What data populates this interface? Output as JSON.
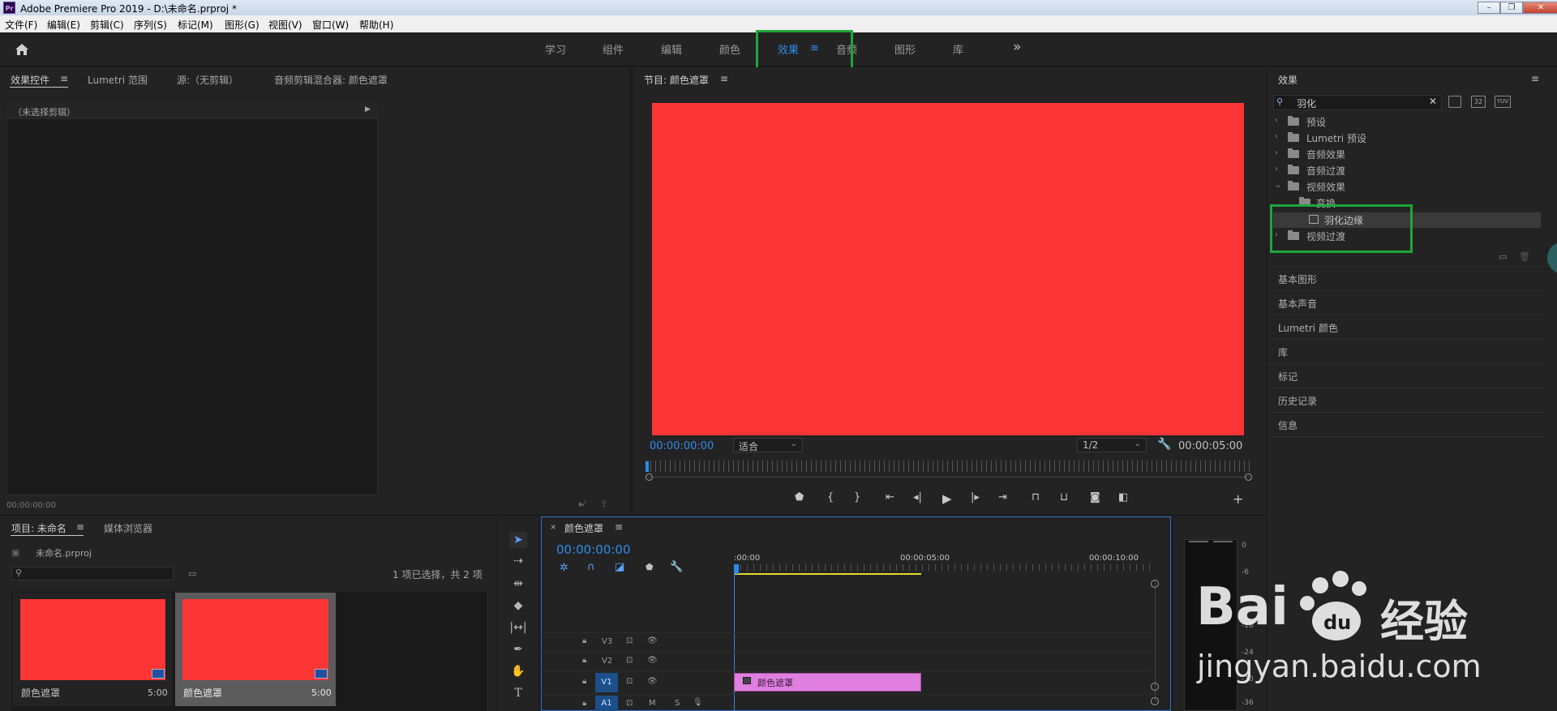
{
  "window": {
    "app_icon": "Pr",
    "title": "Adobe Premiere Pro 2019 - D:\\未命名.prproj *",
    "minimize": "–",
    "restore": "❐",
    "close": "✕"
  },
  "menu": [
    "文件(F)",
    "编辑(E)",
    "剪辑(C)",
    "序列(S)",
    "标记(M)",
    "图形(G)",
    "视图(V)",
    "窗口(W)",
    "帮助(H)"
  ],
  "workspaces": {
    "items": [
      "学习",
      "组件",
      "编辑",
      "颜色",
      "效果",
      "音频",
      "图形",
      "库"
    ],
    "active": "效果",
    "more": "»"
  },
  "effect_controls": {
    "tabs": [
      "效果控件",
      "Lumetri 范围",
      "源:（无剪辑）",
      "音频剪辑混合器: 颜色遮罩"
    ],
    "no_clip": "（未选择剪辑）",
    "timecode": "00:00:00:00"
  },
  "program_monitor": {
    "title": "节目: 颜色遮罩",
    "timecode": "00:00:00:00",
    "fit": "适合",
    "resolution": "1/2",
    "duration": "00:00:05:00",
    "frame_color": "#fd3535"
  },
  "effects_panel": {
    "title": "效果",
    "search_value": "羽化",
    "tree": [
      {
        "label": "预设",
        "chev": "›"
      },
      {
        "label": "Lumetri 预设",
        "chev": "›"
      },
      {
        "label": "音频效果",
        "chev": "›"
      },
      {
        "label": "音频过渡",
        "chev": "›"
      },
      {
        "label": "视频效果",
        "chev": "⌄"
      },
      {
        "label": "变换",
        "chev": ""
      },
      {
        "label": "羽化边缘",
        "chev": ""
      },
      {
        "label": "视频过渡",
        "chev": "›"
      }
    ],
    "badges": [
      "32",
      "YUV"
    ]
  },
  "side_panels": [
    "基本图形",
    "基本声音",
    "Lumetri 颜色",
    "库",
    "标记",
    "历史记录",
    "信息"
  ],
  "project": {
    "tabs": [
      "项目: 未命名",
      "媒体浏览器"
    ],
    "file": "未命名.prproj",
    "selection": "1 项已选择，共 2 项",
    "items": [
      {
        "name": "颜色遮罩",
        "duration": "5:00"
      },
      {
        "name": "颜色遮罩",
        "duration": "5:00"
      }
    ]
  },
  "timeline": {
    "close": "×",
    "title": "颜色遮罩",
    "timecode": "00:00:00:00",
    "ruler": [
      ":00:00",
      "00:00:05:00",
      "00:00:10:00"
    ],
    "tracks": [
      "V3",
      "V2",
      "V1",
      "A1"
    ],
    "clip_label": "颜色遮罩",
    "clip_color": "#e07fe0",
    "track_m": "M",
    "track_s": "S"
  },
  "audio_meter": {
    "scale": [
      "0",
      "-6",
      "-12",
      "-18",
      "-24",
      "-30",
      "-36"
    ]
  },
  "watermark": {
    "text1": "Bai",
    "text2": "经验",
    "text3": "jingyan.baidu.com"
  }
}
